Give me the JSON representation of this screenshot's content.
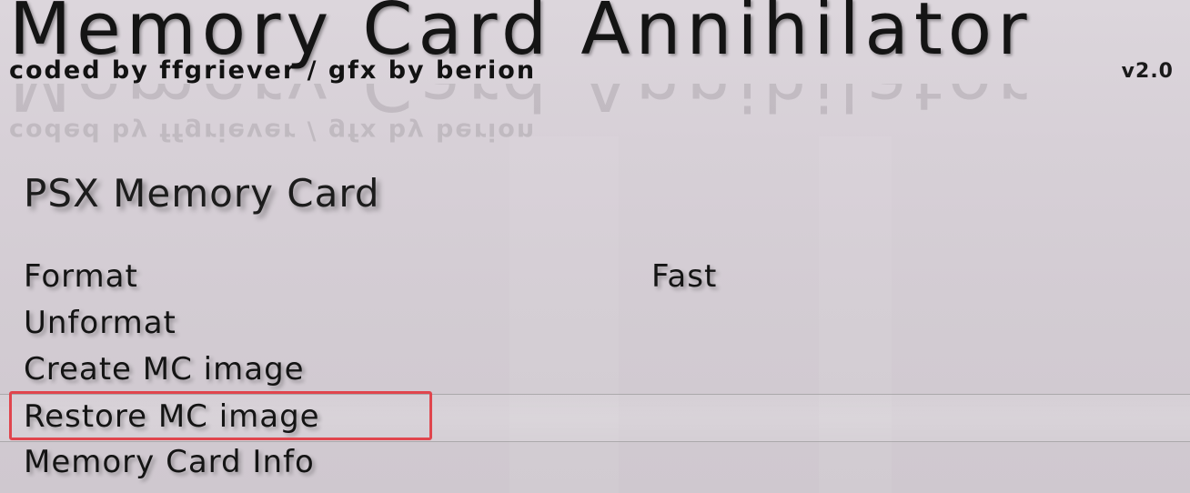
{
  "header": {
    "title": "Memory Card Annihilator",
    "subtitle": "coded by ffgriever / gfx by berion",
    "version": "v2.0"
  },
  "section": {
    "heading": "PSX Memory Card"
  },
  "menu": {
    "items": [
      {
        "label": "Format",
        "value": "Fast"
      },
      {
        "label": "Unformat",
        "value": ""
      },
      {
        "label": "Create MC image",
        "value": ""
      },
      {
        "label": "Restore MC image",
        "value": "",
        "selected": true
      },
      {
        "label": "Memory Card Info",
        "value": ""
      }
    ]
  },
  "colors": {
    "background": "#d7d0d7",
    "text": "#141414",
    "highlight_border": "#e0454d"
  }
}
